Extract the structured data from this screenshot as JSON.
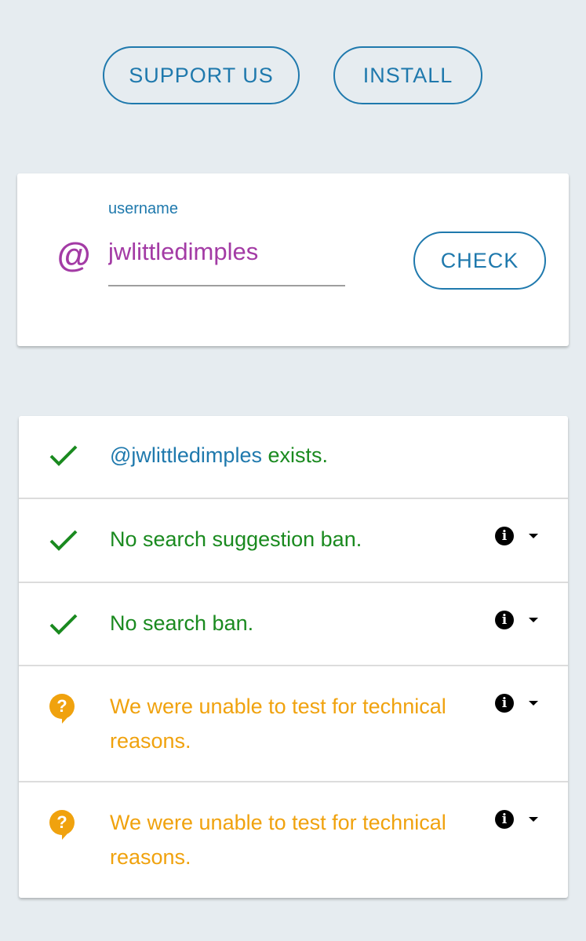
{
  "top_buttons": {
    "support_label": "SUPPORT US",
    "install_label": "INSTALL"
  },
  "user_form": {
    "field_label": "username",
    "at_symbol": "@",
    "username_value": "jwlittledimples",
    "check_label": "CHECK"
  },
  "results": [
    {
      "status": "ok",
      "icon": "checkmark-icon",
      "handle": "@jwlittledimples",
      "text": " exists.",
      "has_info": false
    },
    {
      "status": "ok",
      "icon": "checkmark-icon",
      "text": "No search suggestion ban.",
      "has_info": true
    },
    {
      "status": "ok",
      "icon": "checkmark-icon",
      "text": "No search ban.",
      "has_info": true
    },
    {
      "status": "unknown",
      "icon": "question-bubble-icon",
      "text": "We were unable to test for technical reasons.",
      "has_info": true
    },
    {
      "status": "unknown",
      "icon": "question-bubble-icon",
      "text": "We were unable to test for technical reasons.",
      "has_info": true
    }
  ],
  "colors": {
    "accent_blue": "#1f79ad",
    "username_purple": "#a33ba5",
    "ok_green": "#1a8a1f",
    "warn_orange": "#f0a20e",
    "background": "#e6ecf0"
  }
}
